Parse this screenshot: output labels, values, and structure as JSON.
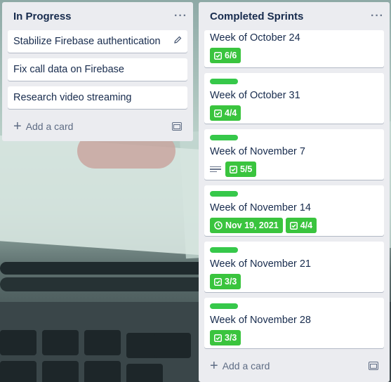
{
  "lists": [
    {
      "title": "In Progress",
      "more": "···",
      "cards": [
        {
          "title": "Stabilize Firebase authentication"
        },
        {
          "title": "Fix call data on Firebase"
        },
        {
          "title": "Research video streaming"
        }
      ],
      "add_card": "Add a card"
    },
    {
      "title": "Completed Sprints",
      "more": "···",
      "cards": [
        {
          "title": "Week of October 24",
          "checklist": "6/6"
        },
        {
          "title": "Week of October 31",
          "checklist": "4/4"
        },
        {
          "title": "Week of November 7",
          "checklist": "5/5"
        },
        {
          "title": "Week of November 14",
          "due": "Nov 19, 2021",
          "checklist": "4/4"
        },
        {
          "title": "Week of November 21",
          "checklist": "3/3"
        },
        {
          "title": "Week of November 28",
          "checklist": "3/3"
        }
      ],
      "add_card": "Add a card"
    }
  ],
  "colors": {
    "label_green": "#36c84a",
    "badge_green": "#3ac43e",
    "list_bg": "#ebecf0",
    "title": "#172b4d"
  }
}
